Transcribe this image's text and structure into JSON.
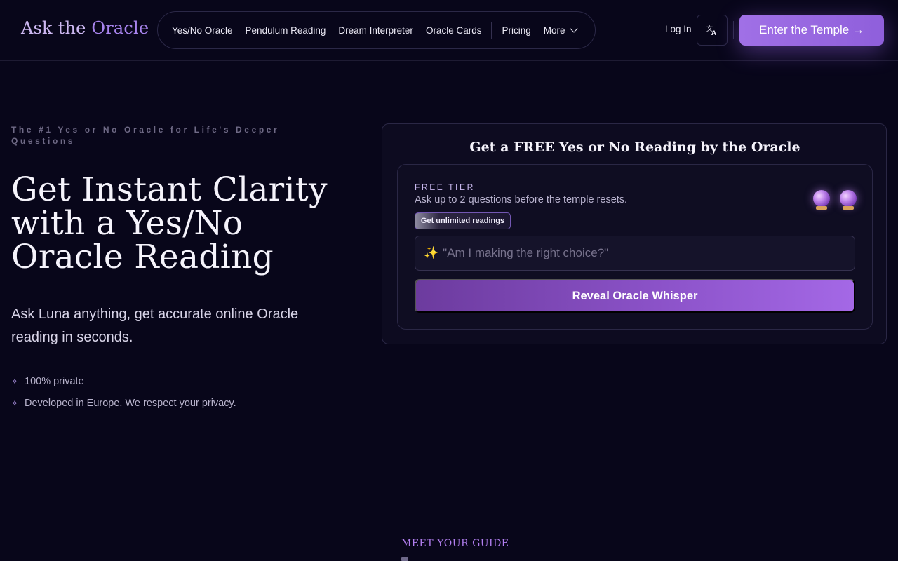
{
  "header": {
    "logo_prefix": "Ask the ",
    "logo_accent": "Oracle",
    "nav": [
      {
        "label": "Yes/No Oracle"
      },
      {
        "label": "Pendulum Reading"
      },
      {
        "label": "Dream Interpreter"
      },
      {
        "label": "Oracle Cards"
      }
    ],
    "pricing": "Pricing",
    "more": "More",
    "login": "Log In",
    "language_icon": "translate-icon",
    "cta": "Enter the Temple →",
    "accent_color": "#9b6ae4"
  },
  "hero": {
    "eyebrow": "The #1 Yes or No Oracle for Life's Deeper Questions",
    "title": "Get Instant Clarity with a Yes/No Oracle Reading",
    "subtitle": "Ask Luna anything, get accurate online Oracle reading in seconds.",
    "bullets": [
      {
        "icon": "sparkle-icon",
        "text": "100% private"
      },
      {
        "icon": "sparkle-icon",
        "text": "Developed in Europe. We respect your privacy."
      }
    ]
  },
  "reading_card": {
    "title": "Get a FREE Yes or No Reading by the Oracle",
    "tier_label": "FREE TIER",
    "tier_desc": "Ask up to 2 questions before the temple resets.",
    "remaining_questions": 2,
    "unlimited_button": "Get unlimited readings",
    "input_placeholder": "\"Am I making the right choice?\"",
    "input_value": "",
    "reveal_button": "Reveal Oracle Whisper"
  },
  "guide": {
    "label": "MEET YOUR GUIDE"
  }
}
